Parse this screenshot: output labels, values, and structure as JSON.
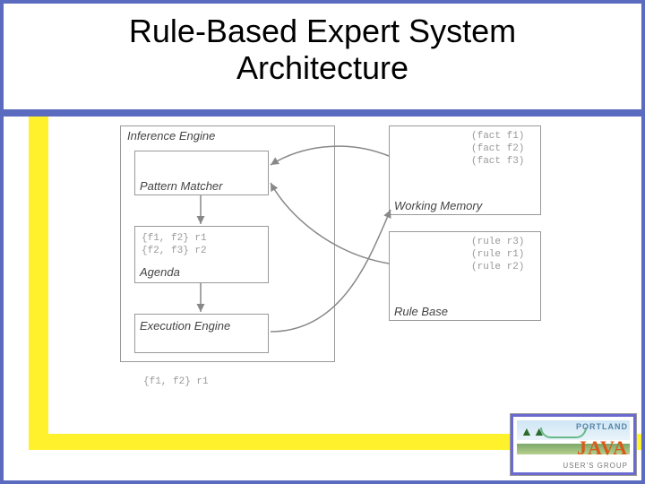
{
  "title_line1": "Rule-Based Expert System",
  "title_line2": "Architecture",
  "diagram": {
    "inference_engine": "Inference Engine",
    "pattern_matcher": "Pattern Matcher",
    "agenda": "Agenda",
    "agenda_content": "{f1, f2} r1\n{f2, f3} r2",
    "execution_engine": "Execution Engine",
    "execution_content": "{f1, f2} r1",
    "working_memory": "Working Memory",
    "working_memory_content": "(fact f1)\n(fact f2)\n(fact f3)",
    "rule_base": "Rule Base",
    "rule_base_content": "(rule r3)\n(rule r1)\n(rule r2)"
  },
  "logo": {
    "top": "PORTLAND",
    "main": "JAVA",
    "sub": "USER'S GROUP"
  }
}
